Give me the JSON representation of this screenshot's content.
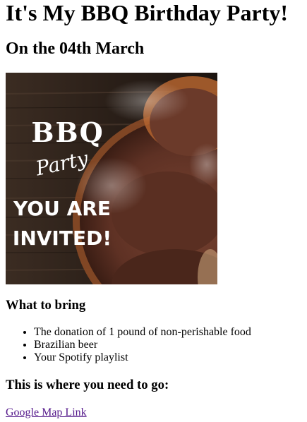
{
  "heading": "It's My BBQ Birthday Party!",
  "date_heading": "On the 04th March",
  "invite_image": {
    "alt": "BBQ Party - You are invited!",
    "line1": "BBQ",
    "line2": "Party",
    "line3": "YOU ARE",
    "line4": "INVITED!",
    "colors": {
      "wood_dark": "#2a1f18",
      "wood_light": "#4a3a2e",
      "meat": "#6b3a2a",
      "crust": "#b4642f",
      "text": "#ffffff"
    }
  },
  "bring_section": {
    "title": "What to bring",
    "items": [
      "The donation of 1 pound of non-perishable food",
      "Brazilian beer",
      "Your Spotify playlist"
    ]
  },
  "location_section": {
    "title": "This is where you need to go:",
    "link_text": "Google Map Link"
  }
}
